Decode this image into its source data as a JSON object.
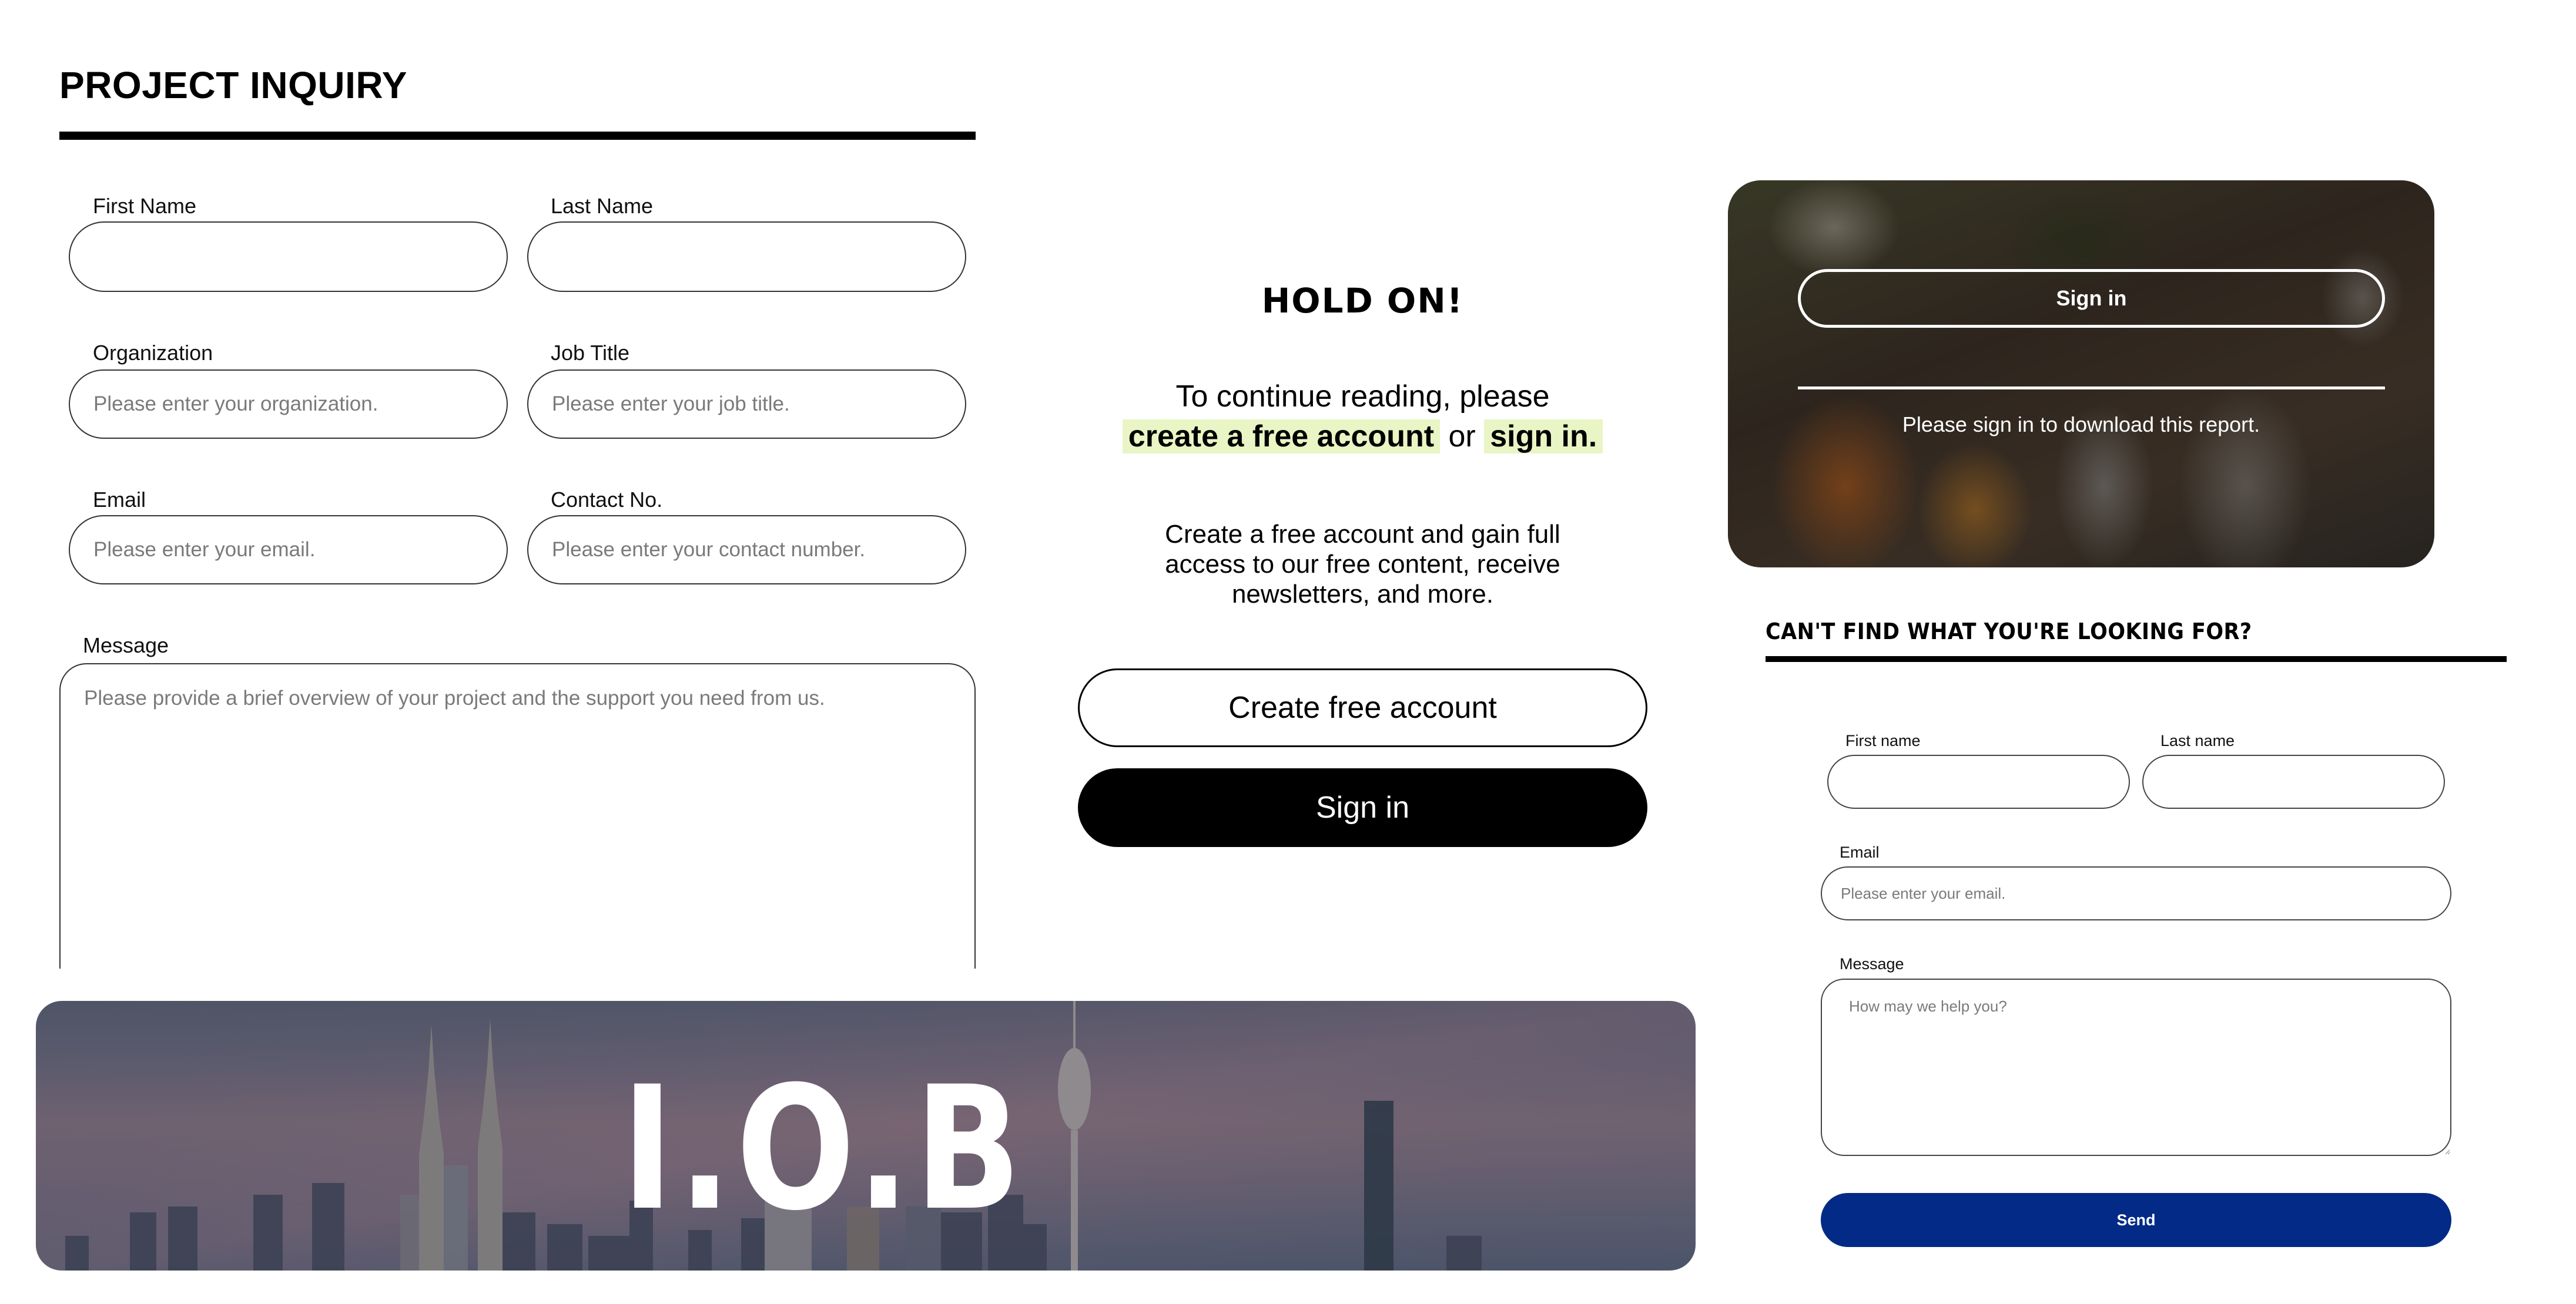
{
  "project_inquiry": {
    "title": "PROJECT INQUIRY",
    "fields": {
      "first_name": {
        "label": "First Name",
        "placeholder": "",
        "value": ""
      },
      "last_name": {
        "label": "Last Name",
        "placeholder": "",
        "value": ""
      },
      "organization": {
        "label": "Organization",
        "placeholder": "Please enter your organization.",
        "value": ""
      },
      "job_title": {
        "label": "Job Title",
        "placeholder": "Please enter your job title.",
        "value": ""
      },
      "email": {
        "label": "Email",
        "placeholder": "Please enter your email.",
        "value": ""
      },
      "contact_no": {
        "label": "Contact No.",
        "placeholder": "Please enter your contact number.",
        "value": ""
      },
      "message": {
        "label": "Message",
        "placeholder": "Please provide a brief overview of your project and the support you need from us.",
        "value": ""
      }
    }
  },
  "banner": {
    "logo_text": "I.O.B",
    "image": "city-skyline-dusk"
  },
  "paywall": {
    "title": "HOLD ON!",
    "line1": "To continue reading, please",
    "highlight_create": "create a free account",
    "connector": "or",
    "highlight_signin": "sign in.",
    "description": "Create a free account and gain full access to our free content, receive newsletters, and more.",
    "create_button": "Create free account",
    "signin_button": "Sign in",
    "highlight_color": "#e9f5c4"
  },
  "download_card": {
    "image": "festival-procession-photo",
    "signin_button": "Sign in",
    "message": "Please sign in to download this report."
  },
  "contact_form": {
    "title": "CAN'T FIND WHAT YOU'RE LOOKING FOR?",
    "fields": {
      "first_name": {
        "label": "First name",
        "placeholder": "",
        "value": ""
      },
      "last_name": {
        "label": "Last name",
        "placeholder": "",
        "value": ""
      },
      "email": {
        "label": "Email",
        "placeholder": "Please enter your email.",
        "value": ""
      },
      "message": {
        "label": "Message",
        "placeholder": "How may we help you?",
        "value": ""
      }
    },
    "send_button": "Send",
    "send_color": "#022a86"
  }
}
